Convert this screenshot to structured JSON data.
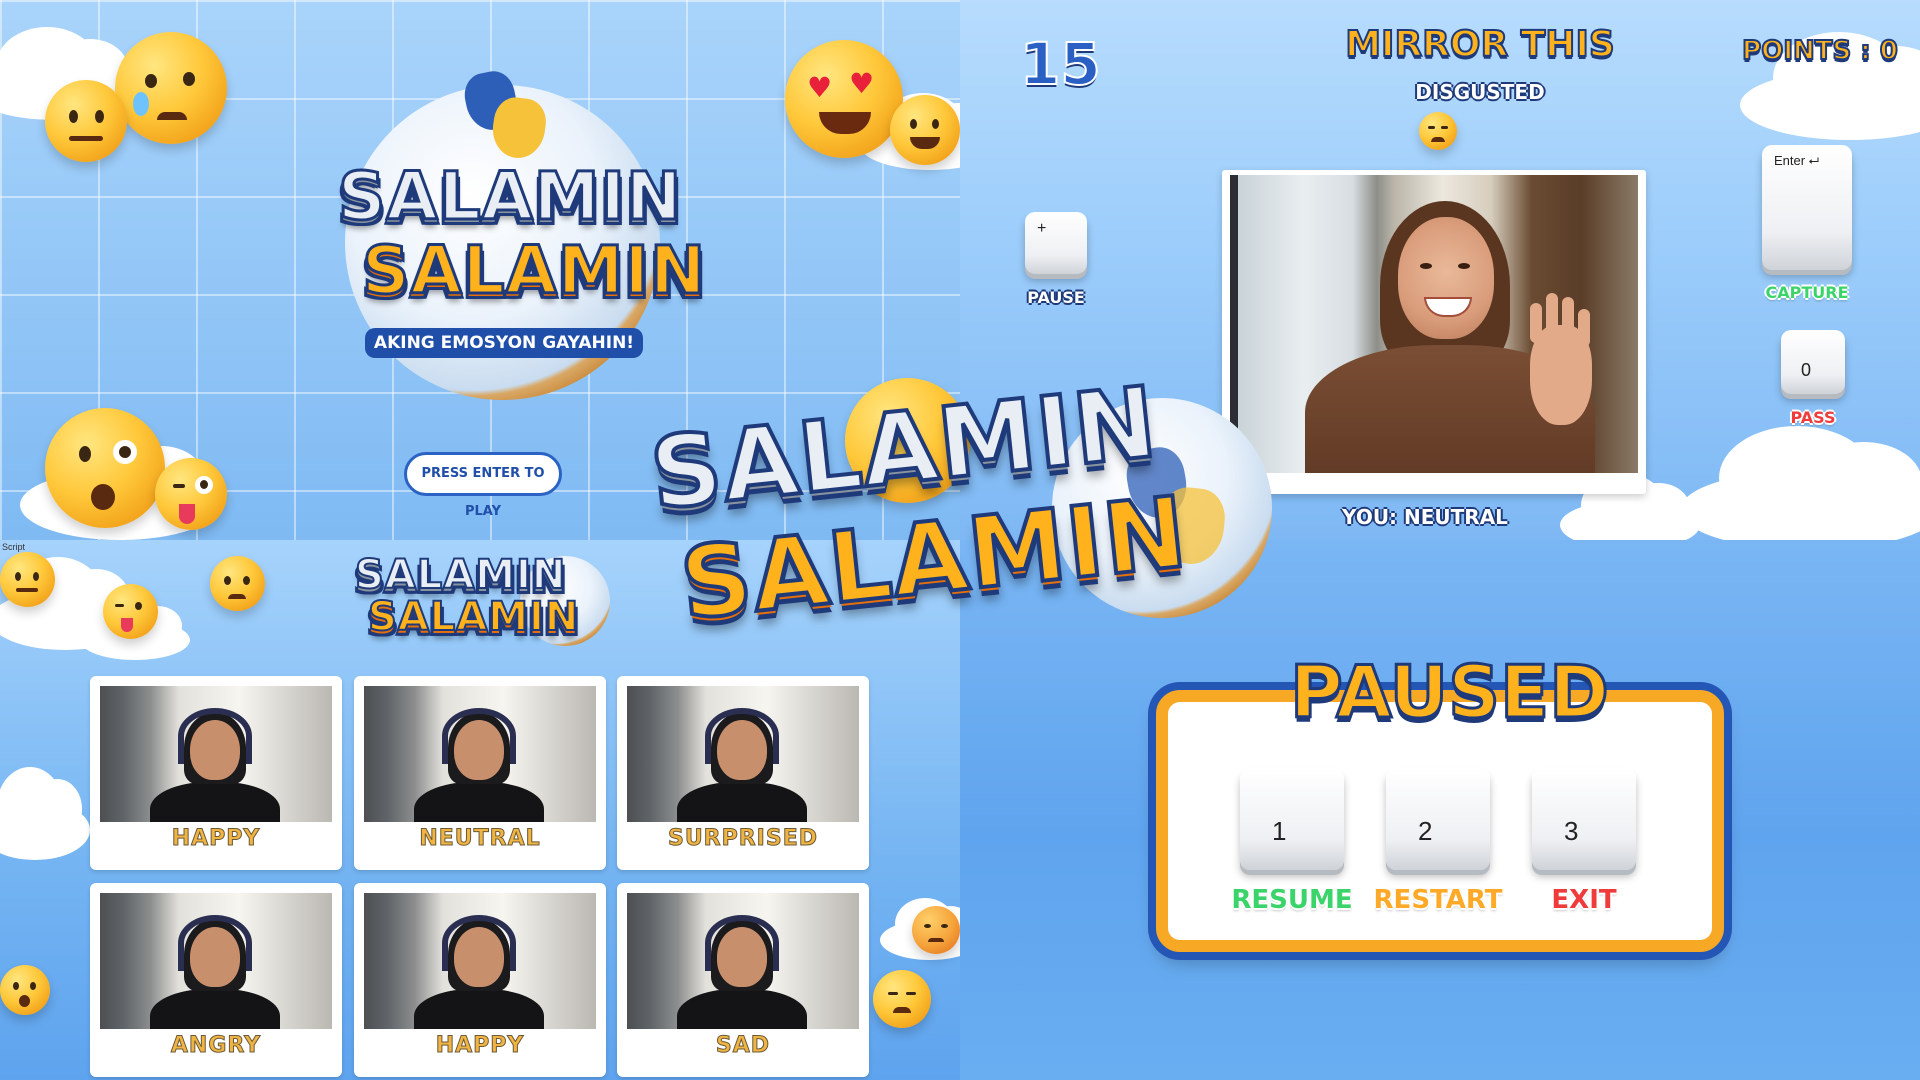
{
  "title_screen": {
    "logo_top": "SALAMIN",
    "logo_bottom": "SALAMIN",
    "tagline": "AKING EMOSYON GAYAHIN!",
    "play_button": "PRESS ENTER TO PLAY"
  },
  "game_screen": {
    "timer": "15",
    "prompt_title": "MIRROR THIS",
    "target_emotion": "DISGUSTED",
    "points_label": "POINTS : 0",
    "pause_key": "+",
    "pause_label": "PAUSE",
    "capture_key": "Enter ⮠",
    "capture_label": "CAPTURE",
    "pass_key": "0",
    "pass_label": "PASS",
    "detected": "YOU: NEUTRAL"
  },
  "center_logo": {
    "top": "SALAMIN",
    "bottom": "SALAMIN"
  },
  "results_screen": {
    "script_label": "Script",
    "logo_top": "SALAMIN",
    "logo_bottom": "SALAMIN",
    "cards": [
      {
        "label": "HAPPY"
      },
      {
        "label": "NEUTRAL"
      },
      {
        "label": "SURPRISED"
      },
      {
        "label": "ANGRY"
      },
      {
        "label": "HAPPY"
      },
      {
        "label": "SAD"
      }
    ]
  },
  "pause_screen": {
    "title": "PAUSED",
    "options": [
      {
        "key": "1",
        "label": "RESUME",
        "color": "#3bd46a"
      },
      {
        "key": "2",
        "label": "RESTART",
        "color": "#ffa928"
      },
      {
        "key": "3",
        "label": "EXIT",
        "color": "#ef3b3b"
      }
    ]
  },
  "colors": {
    "brand_blue": "#1f4fa8",
    "brand_orange": "#ffb21c",
    "sky": "#8fc6f7"
  }
}
